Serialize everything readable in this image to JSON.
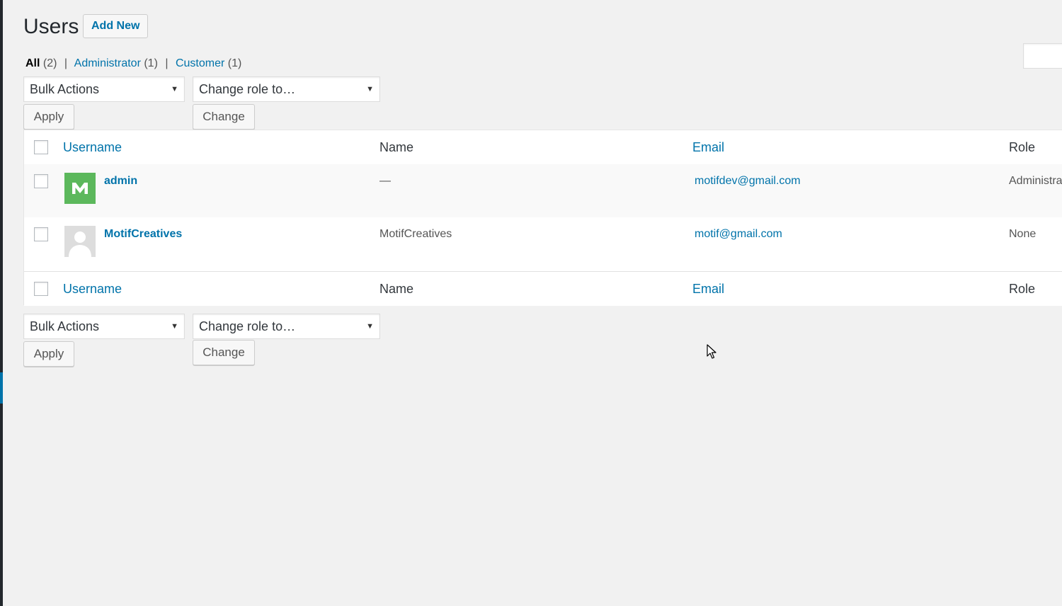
{
  "header": {
    "title": "Users",
    "add_new_label": "Add New"
  },
  "filters": {
    "all": {
      "label": "All",
      "count": "(2)"
    },
    "administrator": {
      "label": "Administrator",
      "count": "(1)"
    },
    "customer": {
      "label": "Customer",
      "count": "(1)"
    },
    "separator": "|"
  },
  "actions": {
    "bulk_actions": "Bulk Actions",
    "change_role": "Change role to…",
    "apply": "Apply",
    "change": "Change",
    "arrow": "▼"
  },
  "table": {
    "columns": {
      "username": "Username",
      "name": "Name",
      "email": "Email",
      "role": "Role"
    },
    "rows": [
      {
        "username": "admin",
        "name": "—",
        "email": "motifdev@gmail.com",
        "role": "Administrator",
        "avatar": "M"
      },
      {
        "username": "MotifCreatives",
        "name": "MotifCreatives",
        "email": "motif@gmail.com",
        "role": "None",
        "avatar": "default"
      }
    ]
  },
  "colors": {
    "link": "#0073aa",
    "avatar_green": "#5cb85c",
    "background": "#f1f1f1"
  }
}
